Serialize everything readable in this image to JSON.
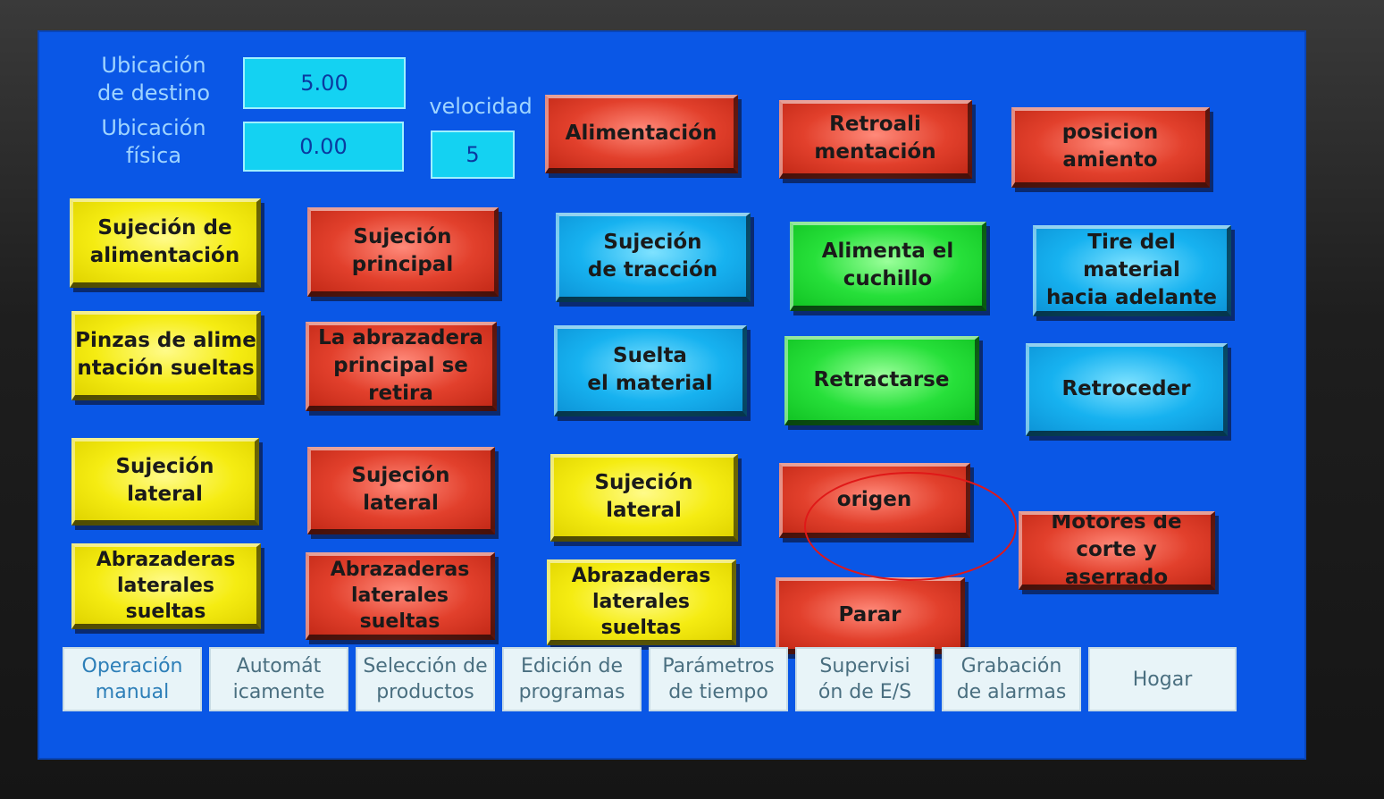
{
  "header": {
    "target_label": "Ubicación\nde destino",
    "target_value": "5.00",
    "physical_label": "Ubicación\nfísica",
    "physical_value": "0.00",
    "speed_label": "velocidad",
    "speed_value": "5"
  },
  "top_buttons": {
    "alimentacion": "Alimentación",
    "retroalimentacion": "Retroali\nmentación",
    "posicionamiento": "posicion\namiento"
  },
  "grid": {
    "sujecion_alimentacion": "Sujeción de\nalimentación",
    "sujecion_principal": "Sujeción\nprincipal",
    "sujecion_traccion": "Sujeción\nde tracción",
    "alimenta_cuchillo": "Alimenta el\ncuchillo",
    "tire_material": "Tire del material\nhacia adelante",
    "pinzas_sueltas": "Pinzas de alime\nntación sueltas",
    "abrazadera_principal": "La abrazadera\nprincipal se retira",
    "suelta_material": "Suelta\nel material",
    "retractarse": "Retractarse",
    "retroceder": "Retroceder",
    "sujecion_lateral_1": "Sujeción\nlateral",
    "sujecion_lateral_2": "Sujeción\nlateral",
    "sujecion_lateral_3": "Sujeción\nlateral",
    "origen": "origen",
    "abrazaderas_1": "Abrazaderas\nlaterales\nsueltas",
    "abrazaderas_2": "Abrazaderas\nlaterales\nsueltas",
    "abrazaderas_3": "Abrazaderas\nlaterales\nsueltas",
    "parar": "Parar",
    "motores": "Motores de\ncorte y aserrado"
  },
  "tabs": [
    {
      "label": "Operación\nmanual"
    },
    {
      "label": "Automát\nicamente"
    },
    {
      "label": "Selección de\nproductos"
    },
    {
      "label": "Edición de\nprogramas"
    },
    {
      "label": "Parámetros\nde tiempo"
    },
    {
      "label": "Supervisi\nón de E/S"
    },
    {
      "label": "Grabación\nde alarmas"
    },
    {
      "label": "Hogar"
    }
  ],
  "colors": {
    "screen": "#0a57e6",
    "red": "#e2402c",
    "yellow": "#f5ec12",
    "cyan": "#17b2f0",
    "green": "#27e03a",
    "annotation": "#e01818"
  }
}
